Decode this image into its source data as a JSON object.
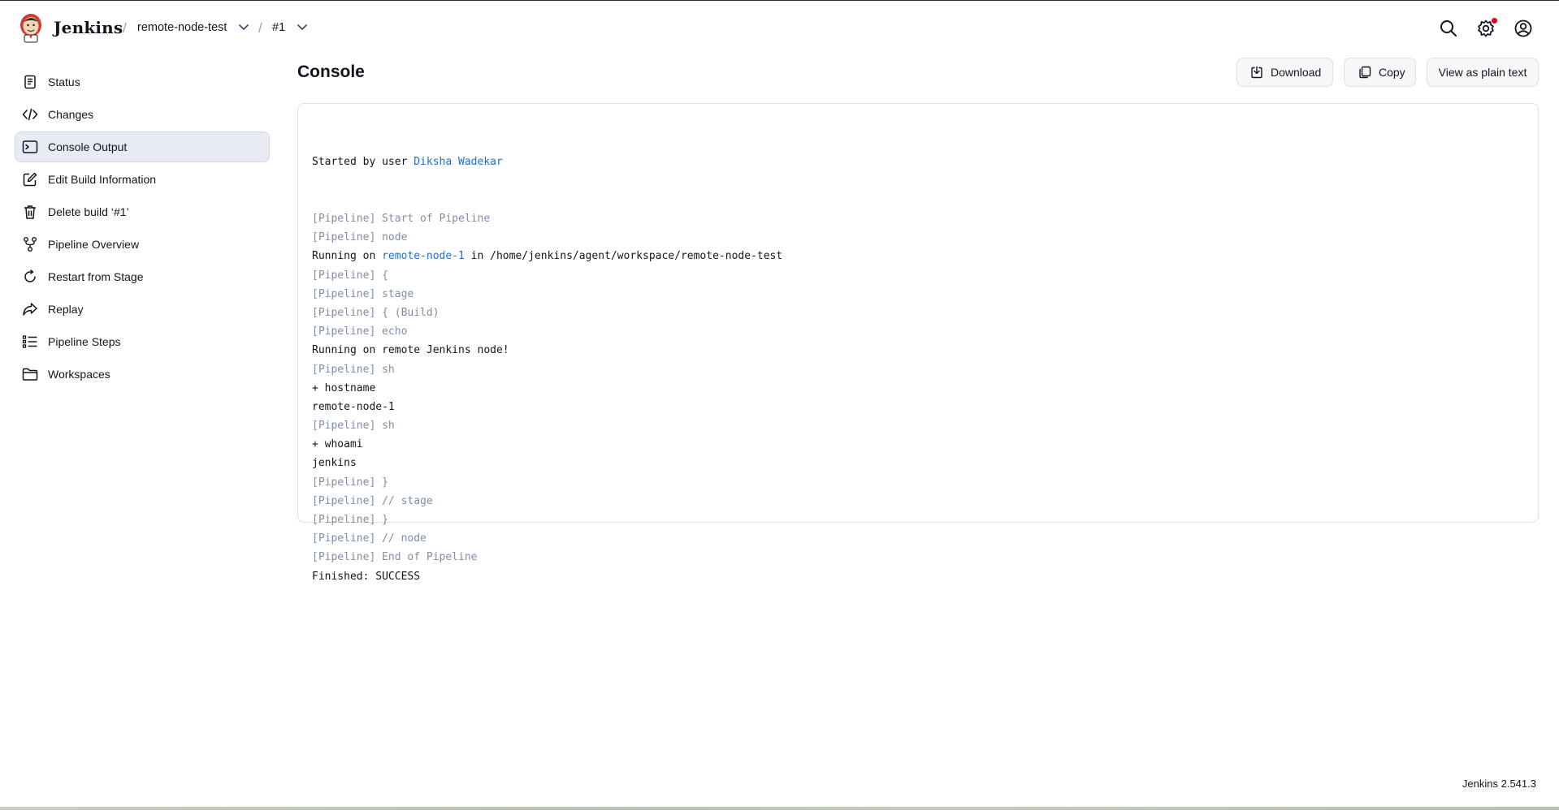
{
  "app": {
    "name": "Jenkins"
  },
  "breadcrumbs": [
    {
      "label": "remote-node-test"
    },
    {
      "label": "#1"
    }
  ],
  "header_icons": [
    "search-icon",
    "manage-gear-icon",
    "user-account-icon"
  ],
  "sidebar": {
    "items": [
      {
        "label": "Status",
        "icon": "status-icon"
      },
      {
        "label": "Changes",
        "icon": "code-icon"
      },
      {
        "label": "Console Output",
        "icon": "terminal-icon",
        "active": true
      },
      {
        "label": "Edit Build Information",
        "icon": "edit-icon"
      },
      {
        "label": "Delete build ‘#1’",
        "icon": "trash-icon"
      },
      {
        "label": "Pipeline Overview",
        "icon": "pipeline-branch-icon"
      },
      {
        "label": "Restart from Stage",
        "icon": "restart-icon"
      },
      {
        "label": "Replay",
        "icon": "replay-icon"
      },
      {
        "label": "Pipeline Steps",
        "icon": "list-icon"
      },
      {
        "label": "Workspaces",
        "icon": "folder-icon"
      }
    ]
  },
  "main": {
    "title": "Console",
    "actions": {
      "download": "Download",
      "copy": "Copy",
      "plain": "View as plain text"
    }
  },
  "console": {
    "started_prefix": "Started by user ",
    "started_user": "Diksha Wadekar",
    "running_prefix": "Running on ",
    "running_node": "remote-node-1",
    "running_suffix": " in /home/jenkins/agent/workspace/remote-node-test",
    "lines": [
      "[Pipeline] Start of Pipeline",
      "[Pipeline] node",
      "[Pipeline] {",
      "[Pipeline] stage",
      "[Pipeline] { (Build)",
      "[Pipeline] echo",
      "Running on remote Jenkins node!",
      "[Pipeline] sh",
      "+ hostname",
      "remote-node-1",
      "[Pipeline] sh",
      "+ whoami",
      "jenkins",
      "[Pipeline] }",
      "[Pipeline] // stage",
      "[Pipeline] }",
      "[Pipeline] // node",
      "[Pipeline] End of Pipeline",
      "Finished: SUCCESS"
    ]
  },
  "footer": {
    "version": "Jenkins 2.541.3"
  },
  "colors": {
    "accent_link": "#1f6fd1",
    "pipeline_text": "#7f8fa8",
    "active_item_bg": "#e8ebf3",
    "notification_dot": "#e6001f"
  }
}
